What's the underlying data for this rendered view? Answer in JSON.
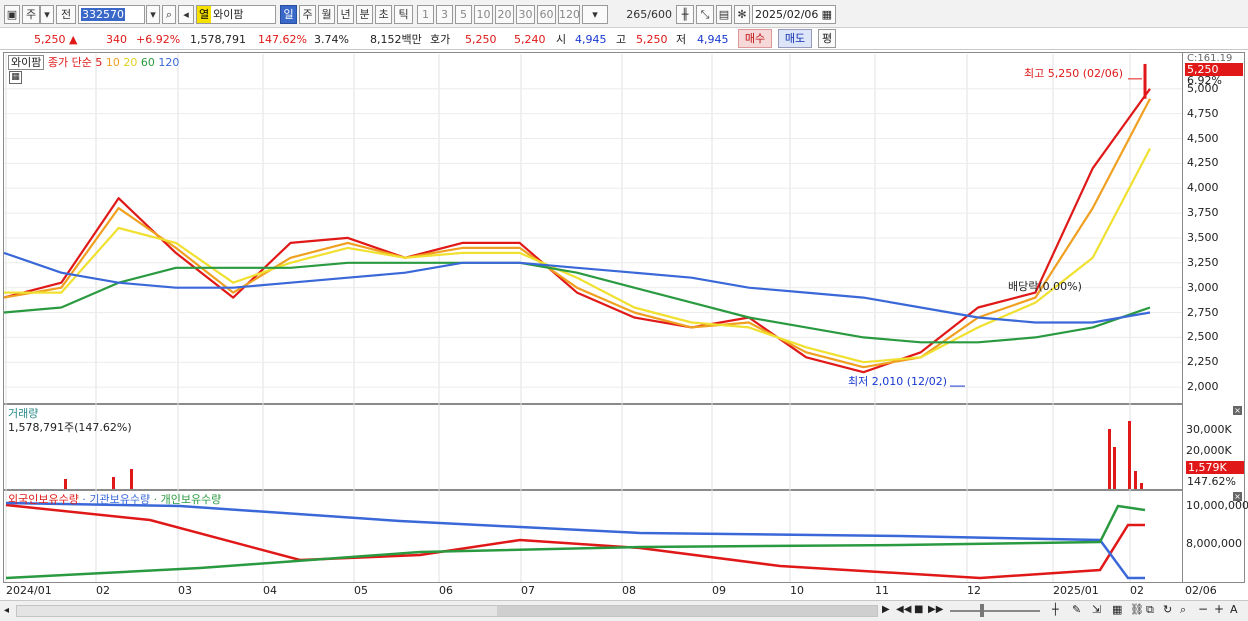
{
  "toolbar": {
    "type_label": "주",
    "all_label": "전",
    "stock_code": "332570",
    "stock_tag": "열",
    "stock_name": "와이팜",
    "period_buttons": [
      "일",
      "주",
      "월",
      "년",
      "분",
      "초",
      "틱"
    ],
    "active_period": "일",
    "interval_buttons": [
      "1",
      "3",
      "5",
      "10",
      "20",
      "30",
      "60",
      "120"
    ],
    "count": "265",
    "count_max": "/600",
    "date": "2025/02/06"
  },
  "quote": {
    "price": "5,250",
    "change": "340",
    "change_pct": "+6.92%",
    "volume": "1,578,791",
    "volume_pct": "147.62%",
    "turnover_pct": "3.74%",
    "amount": "8,152백만",
    "ask_label": "호가",
    "ask": "5,250",
    "bid": "5,240",
    "open_label": "시",
    "open": "4,945",
    "high_label": "고",
    "high": "5,250",
    "low_label": "저",
    "low": "4,945",
    "buy_label": "매수",
    "sell_label": "매도",
    "avg_label": "평"
  },
  "price_panel": {
    "name_tag": "와이팜",
    "legend_prefix": "종가 단순",
    "ma_periods": [
      "5",
      "10",
      "20",
      "60",
      "120"
    ],
    "ma_colors": [
      "#e01818",
      "#f0a020",
      "#f0e030",
      "#2a9a40",
      "#3a68d8"
    ],
    "top_right": "C:161.19",
    "current_label": "5,250",
    "current_pct": "6.92%",
    "max_annotation": "최고 5,250 (02/06)",
    "min_annotation": "최저 2,010 (12/02)",
    "dividend_annotation": "배당락(0.00%)",
    "y_ticks": [
      "5,000",
      "4,750",
      "4,500",
      "4,250",
      "4,000",
      "3,750",
      "3,500",
      "3,250",
      "3,000",
      "2,750",
      "2,500",
      "2,250",
      "2,000"
    ]
  },
  "volume_panel": {
    "title": "거래량",
    "value": "1,578,791주(147.62%)",
    "y_ticks": [
      "30,000K",
      "20,000K",
      "10,000K"
    ],
    "current_label": "1,579K",
    "current_pct": "147.62%"
  },
  "holding_panel": {
    "legend": [
      "외국인보유수량",
      "기관보유수량",
      "개인보유수량"
    ],
    "legend_colors": [
      "#e01818",
      "#3a68d8",
      "#2a9a40"
    ],
    "y_ticks": [
      "10,000,000",
      "8,000,000"
    ]
  },
  "x_axis": [
    "2024/01",
    "02",
    "03",
    "04",
    "05",
    "06",
    "07",
    "08",
    "09",
    "10",
    "11",
    "12",
    "2025/01",
    "02",
    "02/06"
  ],
  "chart_data": {
    "type": "line",
    "title": "",
    "xlabel": "",
    "ylabel": "",
    "x": [
      "2024/01",
      "2024/02",
      "2024/02b",
      "2024/03",
      "2024/04",
      "2024/05",
      "2024/05b",
      "2024/06",
      "2024/07",
      "2024/07b",
      "2024/08",
      "2024/08b",
      "2024/09",
      "2024/10",
      "2024/11",
      "2024/12",
      "2024/12b",
      "2025/01",
      "2025/01b",
      "2025/02",
      "2025/02/06"
    ],
    "ylim": [
      2000,
      5250
    ],
    "series": [
      {
        "name": "5",
        "values": [
          2900,
          3050,
          3900,
          3350,
          2900,
          3450,
          3500,
          3300,
          3450,
          3450,
          2950,
          2700,
          2600,
          2700,
          2300,
          2150,
          2350,
          2800,
          2950,
          4200,
          5000
        ]
      },
      {
        "name": "10",
        "values": [
          2900,
          3000,
          3800,
          3400,
          2950,
          3300,
          3450,
          3300,
          3400,
          3400,
          3000,
          2750,
          2600,
          2650,
          2350,
          2200,
          2300,
          2700,
          2900,
          3800,
          4900
        ]
      },
      {
        "name": "20",
        "values": [
          2950,
          2950,
          3600,
          3450,
          3050,
          3250,
          3400,
          3300,
          3350,
          3350,
          3100,
          2800,
          2650,
          2600,
          2400,
          2250,
          2300,
          2600,
          2850,
          3300,
          4400
        ]
      },
      {
        "name": "60",
        "values": [
          2750,
          2800,
          3050,
          3200,
          3200,
          3200,
          3250,
          3250,
          3250,
          3250,
          3150,
          3000,
          2850,
          2700,
          2600,
          2500,
          2450,
          2450,
          2500,
          2600,
          2800
        ]
      },
      {
        "name": "120",
        "values": [
          3350,
          3150,
          3050,
          3000,
          3000,
          3050,
          3100,
          3150,
          3250,
          3250,
          3200,
          3150,
          3100,
          3000,
          2950,
          2900,
          2800,
          2700,
          2650,
          2650,
          2750
        ]
      }
    ]
  }
}
